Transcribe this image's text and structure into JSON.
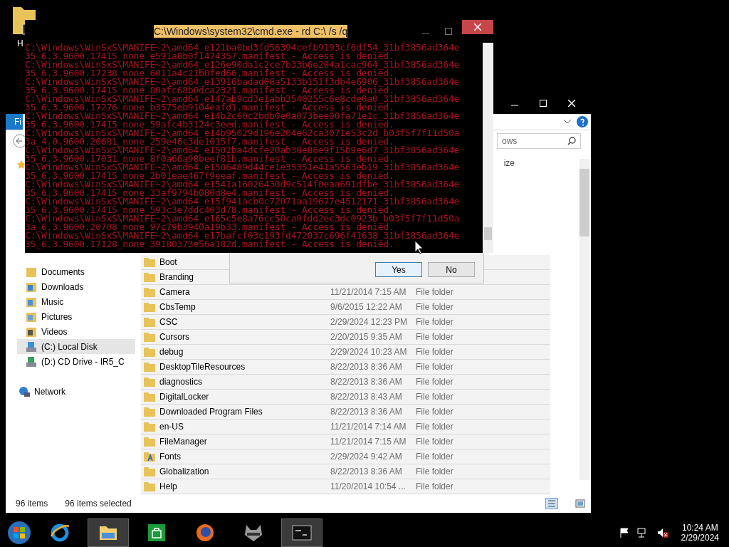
{
  "desktop": {
    "icons": [
      {
        "label": "H"
      }
    ]
  },
  "explorer": {
    "file_tab": "Fi",
    "search": {
      "value": "ows"
    },
    "column_header": "ize",
    "nav_items": [
      {
        "label": "Documents",
        "kind": "documents",
        "selected": false
      },
      {
        "label": "Downloads",
        "kind": "downloads",
        "selected": false
      },
      {
        "label": "Music",
        "kind": "music",
        "selected": false
      },
      {
        "label": "Pictures",
        "kind": "pictures",
        "selected": false
      },
      {
        "label": "Videos",
        "kind": "videos",
        "selected": false
      },
      {
        "label": "(C:) Local Disk",
        "kind": "disk",
        "selected": true
      },
      {
        "label": "(D:) CD Drive - IR5_C",
        "kind": "cd",
        "selected": false
      },
      {
        "label": "Network",
        "kind": "network",
        "selected": false
      }
    ],
    "files": [
      {
        "name": "Boot",
        "kind": "folder"
      },
      {
        "name": "Branding",
        "kind": "folder"
      },
      {
        "name": "Camera",
        "date": "11/21/2014 7:15 AM",
        "type": "File folder",
        "kind": "folder"
      },
      {
        "name": "CbsTemp",
        "date": "9/6/2015 12:22 AM",
        "type": "File folder",
        "kind": "folder"
      },
      {
        "name": "CSC",
        "date": "2/29/2024 12:23 PM",
        "type": "File folder",
        "kind": "folder"
      },
      {
        "name": "Cursors",
        "date": "2/20/2015 9:35 AM",
        "type": "File folder",
        "kind": "folder"
      },
      {
        "name": "debug",
        "date": "2/29/2024 10:23 AM",
        "type": "File folder",
        "kind": "folder"
      },
      {
        "name": "DesktopTileResources",
        "date": "8/22/2013 8:36 AM",
        "type": "File folder",
        "kind": "folder"
      },
      {
        "name": "diagnostics",
        "date": "8/22/2013 8:36 AM",
        "type": "File folder",
        "kind": "folder"
      },
      {
        "name": "DigitalLocker",
        "date": "8/22/2013 8:43 AM",
        "type": "File folder",
        "kind": "folder"
      },
      {
        "name": "Downloaded Program Files",
        "date": "8/22/2013 8:36 AM",
        "type": "File folder",
        "kind": "folder"
      },
      {
        "name": "en-US",
        "date": "11/21/2014 7:14 AM",
        "type": "File folder",
        "kind": "folder"
      },
      {
        "name": "FileManager",
        "date": "11/21/2014 7:15 AM",
        "type": "File folder",
        "kind": "folder"
      },
      {
        "name": "Fonts",
        "date": "2/29/2024 9:42 AM",
        "type": "File folder",
        "kind": "fonts"
      },
      {
        "name": "Globalization",
        "date": "8/22/2013 8:36 AM",
        "type": "File folder",
        "kind": "folder"
      },
      {
        "name": "Help",
        "date": "11/20/2014 10:54 ...",
        "type": "File folder",
        "kind": "folder"
      }
    ],
    "status": {
      "count": "96 items",
      "selected": "96 items selected"
    }
  },
  "dialog": {
    "buttons": [
      {
        "label": "Yes",
        "selected": true
      },
      {
        "label": "No",
        "selected": false
      }
    ]
  },
  "cmd_window": {
    "title": "C:\\Windows\\system32\\cmd.exe - rd  C:\\ /s /q",
    "lines": [
      "C:\\Windows\\WinSxS\\MANIFE~2\\amd64_e121ba0bd3fd56394cefb9193cf6df54_31bf3856ad364e",
      "35_6.3.9600.17415_none_e591a8b0f1474357.manifest - Access is denied.",
      "C:\\Windows\\WinSxS\\MANIFE~2\\amd64_e126e90da1c2ce7b33b6e204a1cac964_31bf3856ad364e",
      "35_6.3.9600.17238_none_6011a4c21b0fed66.manifest - Access is denied.",
      "C:\\Windows\\WinSxS\\MANIFE~2\\amd64_e13916badad00a5133b151f3db4e6906_31bf3856ad364e",
      "35_6.3.9600.17415_none_80afc68b0dca2321.manifest - Access is denied.",
      "C:\\Windows\\WinSxS\\MANIFE~2\\amd64_e147ab9cd3e1abb3540255c6e8cde0a0_31bf3856ad364e",
      "35_6.3.9600.17276_none_b3575eb9104eafd1.manifest - Access is denied.",
      "C:\\Windows\\WinSxS\\MANIFE~2\\amd64_e14b2c60c2bdb0e0a073bee00fa71e1c_31bf3856ad364e",
      "35_6.3.9600.17415_none_59afc4b3124c3eed.manifest - Access is denied.",
      "C:\\Windows\\WinSxS\\MANIFE~2\\amd64_e14b95029d196e204e62ca3071e53c2d_b03f5f7f11d50a",
      "3a_4.0.9600.20681_none_259e46c3de1015f7.manifest - Access is denied.",
      "C:\\Windows\\WinSxS\\MANIFE~2\\amd64_e1502ba4dcfe20ab38e86e9f15b9e6d7_31bf3856ad364e",
      "35_6.3.9600.17031_none_8f0a66a98beef81b.manifest - Access is denied.",
      "C:\\Windows\\WinSxS\\MANIFE~2\\amd64_e1506489d44ce1e35351e41a5563eb19_31bf3856ad364e",
      "35_6.3.9600.17415_none_2b01eae467f9eeaf.manifest - Access is denied.",
      "C:\\Windows\\WinSxS\\MANIFE~2\\amd64_e1541a16026430d9c514f0eaa691dfbe_31bf3856ad364e",
      "35_6.3.9600.17415_none_33af9794b080d8e4.manifest - Access is denied.",
      "C:\\Windows\\WinSxS\\MANIFE~2\\amd64_e15f941acb0c72071aa19677e4512171_31bf3856ad364e",
      "35_6.3.9600.17415_none_593c3e7ddc403d78.manifest - Access is denied.",
      "C:\\Windows\\WinSxS\\MANIFE~2\\amd64_e165c5e8a76cc50ca0fdd2ec3dc0923b_b03f5f7f11d50a",
      "3a_6.3.9600.20708_none_97c79b3940a19b33.manifest - Access is denied.",
      "C:\\Windows\\WinSxS\\MANIFE~2\\amd64_e17bafcf03c193fd472037c696f41638_31bf3856ad364e",
      "35_6.3.9600.17128_none_39180373e56a182d.manifest - Access is denied."
    ]
  },
  "taskbar": {
    "apps": [
      {
        "kind": "ie",
        "active": false
      },
      {
        "kind": "explorer",
        "active": true
      },
      {
        "kind": "store",
        "active": false
      },
      {
        "kind": "firefox",
        "active": false
      },
      {
        "kind": "raccoon",
        "active": false
      },
      {
        "kind": "cmd",
        "active": true
      }
    ],
    "time": "10:24 AM",
    "date": "2/29/2024"
  }
}
